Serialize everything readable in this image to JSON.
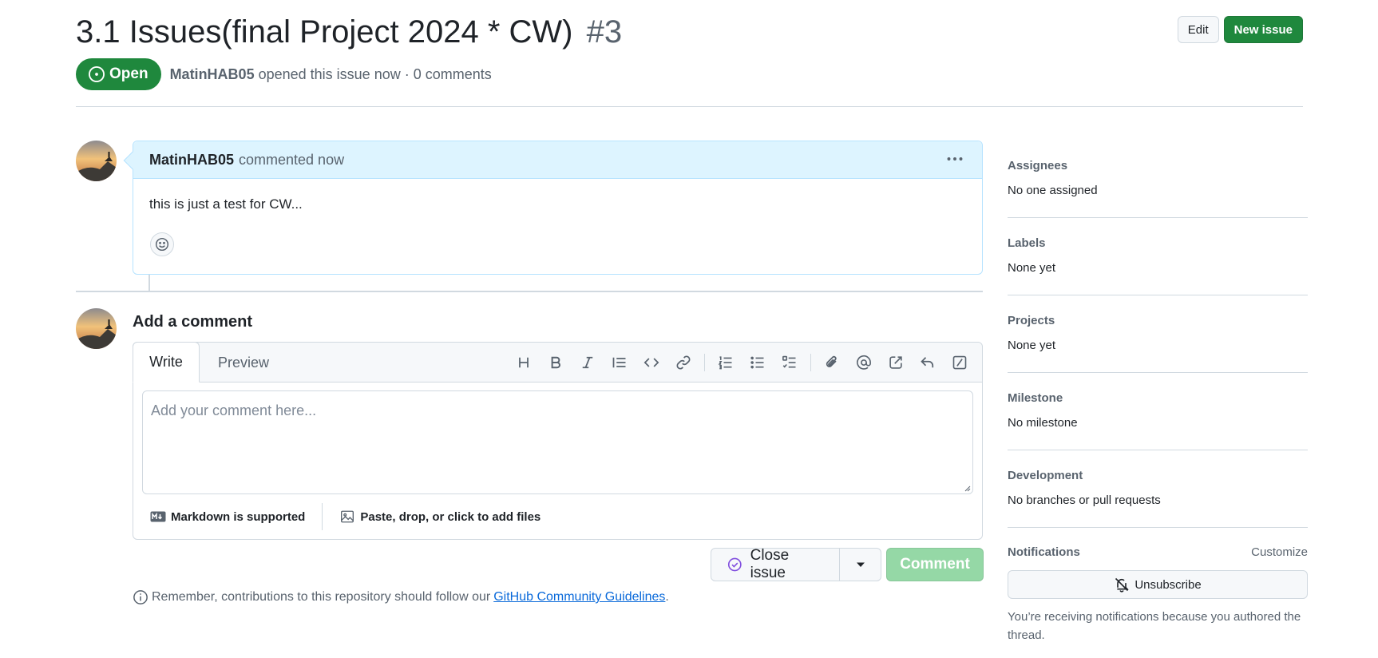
{
  "issue": {
    "title": "3.1 Issues(final Project 2024 * CW)",
    "number": "#3",
    "state": "Open",
    "author": "MatinHAB05",
    "meta_text": "opened this issue now · 0 comments",
    "edit_label": "Edit",
    "new_issue_label": "New issue"
  },
  "comment": {
    "author": "MatinHAB05",
    "action": "commented now",
    "body": "this is just a test for CW..."
  },
  "composer": {
    "title": "Add a comment",
    "tab_write": "Write",
    "tab_preview": "Preview",
    "placeholder": "Add your comment here...",
    "markdown_label": "Markdown is supported",
    "attach_label": "Paste, drop, or click to add files",
    "close_issue_label": "Close issue",
    "comment_label": "Comment"
  },
  "guidelines": {
    "text": "Remember, contributions to this repository should follow our",
    "link": "GitHub Community Guidelines",
    "end": "."
  },
  "sidebar": {
    "assignees": {
      "label": "Assignees",
      "value": "No one assigned"
    },
    "labels": {
      "label": "Labels",
      "value": "None yet"
    },
    "projects": {
      "label": "Projects",
      "value": "None yet"
    },
    "milestone": {
      "label": "Milestone",
      "value": "No milestone"
    },
    "development": {
      "label": "Development",
      "value": "No branches or pull requests"
    },
    "notifications": {
      "label": "Notifications",
      "customize": "Customize",
      "unsubscribe": "Unsubscribe",
      "note": "You’re receiving notifications because you authored the thread."
    }
  },
  "colors": {
    "open_green": "#1f883d",
    "comment_header_bg": "#ddf4ff",
    "comment_border": "#b6e3ff",
    "link_blue": "#0969da",
    "disabled_green": "#95d8a6"
  }
}
